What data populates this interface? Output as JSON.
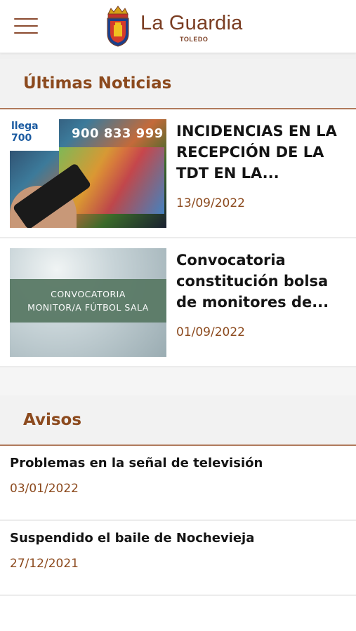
{
  "header": {
    "menu_icon": "hamburger-menu-icon",
    "brand_name": "La Guardia",
    "brand_sub": "TOLEDO",
    "logo_icon": "coat-of-arms-icon"
  },
  "news": {
    "section_title": "Últimas Noticias",
    "items": [
      {
        "title": "INCIDENCIAS EN LA RECEPCIÓN DE LA TDT EN LA...",
        "date": "13/09/2022",
        "thumb_badge_line1": "llega",
        "thumb_badge_line2": "700",
        "thumb_phone": "900 833 999"
      },
      {
        "title": "Convocatoria constitución bolsa de monitores de...",
        "date": "01/09/2022",
        "thumb_line1": "CONVOCATORIA",
        "thumb_line2": "MONITOR/A FÚTBOL SALA"
      }
    ]
  },
  "avisos": {
    "section_title": "Avisos",
    "items": [
      {
        "title": "Problemas en la señal de televisión",
        "date": "03/01/2022"
      },
      {
        "title": "Suspendido el baile de Nochevieja",
        "date": "27/12/2021"
      }
    ]
  },
  "colors": {
    "accent": "#8c4a1e",
    "brand": "#7a3d22",
    "section_bg": "#f2f2f2"
  }
}
